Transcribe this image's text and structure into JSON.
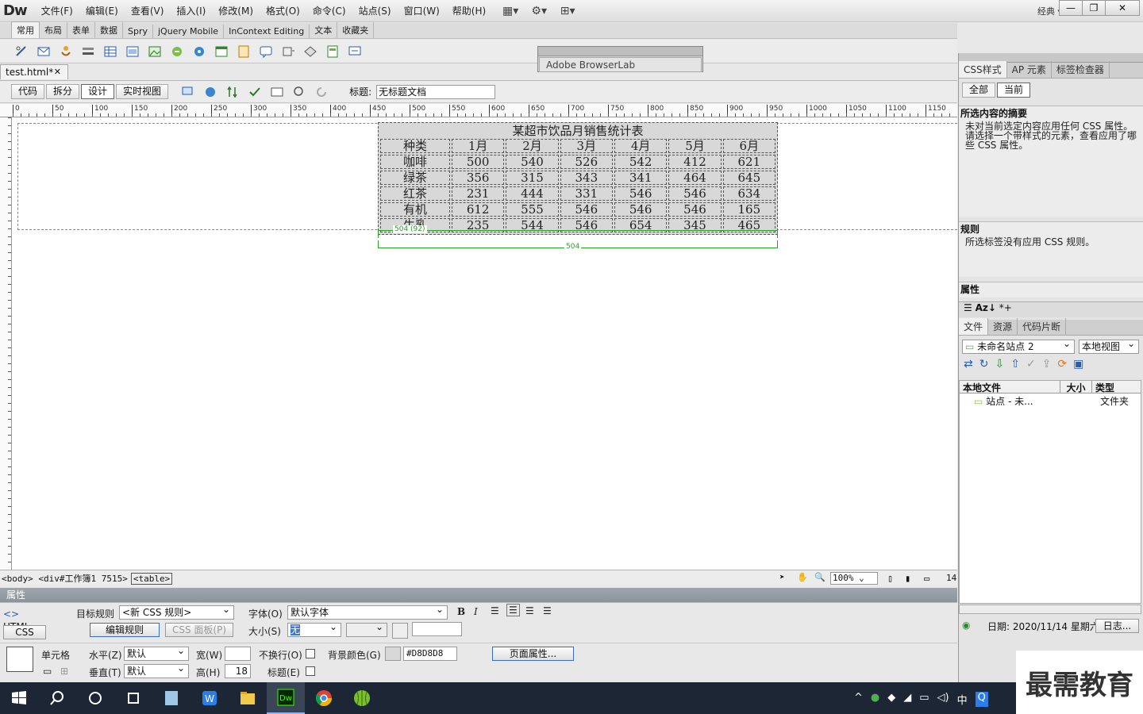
{
  "app": {
    "logo": "Dw",
    "workspace": "经典"
  },
  "menu": [
    "文件(F)",
    "编辑(E)",
    "查看(V)",
    "插入(I)",
    "修改(M)",
    "格式(O)",
    "命令(C)",
    "站点(S)",
    "窗口(W)",
    "帮助(H)"
  ],
  "insert_tabs": [
    "常用",
    "布局",
    "表单",
    "数据",
    "Spry",
    "jQuery Mobile",
    "InContext Editing",
    "文本",
    "收藏夹"
  ],
  "browserlab": {
    "label": "Adobe BrowserLab"
  },
  "doc": {
    "tab": "test.html*",
    "views": [
      "代码",
      "拆分",
      "设计",
      "实时视图"
    ],
    "title_label": "标题:",
    "title_value": "无标题文档"
  },
  "ruler_ticks": [
    "0",
    "50",
    "100",
    "150",
    "200",
    "250",
    "300",
    "350",
    "400",
    "450",
    "500",
    "550",
    "600",
    "650",
    "700",
    "750",
    "800",
    "850",
    "900",
    "950",
    "1000",
    "1050",
    "1100",
    "1150"
  ],
  "table": {
    "caption": "某超市饮品月销售统计表",
    "header": [
      "种类",
      "1月",
      "2月",
      "3月",
      "4月",
      "5月",
      "6月"
    ],
    "rows": [
      [
        "咖啡",
        "500",
        "540",
        "526",
        "542",
        "412",
        "621"
      ],
      [
        "绿茶",
        "356",
        "315",
        "343",
        "341",
        "464",
        "645"
      ],
      [
        "红茶",
        "231",
        "444",
        "331",
        "546",
        "546",
        "634"
      ],
      [
        "有机",
        "612",
        "555",
        "546",
        "546",
        "546",
        "165"
      ],
      [
        "牛乳",
        "235",
        "544",
        "546",
        "654",
        "345",
        "465"
      ]
    ],
    "width_label_1": "504 (92)",
    "width_label_2": "504"
  },
  "statusbar": {
    "tags": "<body> <div#工作簿1 7515>",
    "table_tag": "<table>",
    "zoom": "100%",
    "extra": "14"
  },
  "properties": {
    "header": "属性",
    "html_btn": "HTML",
    "css_btn": "CSS",
    "target_rule_label": "目标规则",
    "target_rule_value": "<新 CSS 规则>",
    "edit_rule": "编辑规则",
    "css_panel": "CSS 面板(P)",
    "font_label": "字体(O)",
    "font_value": "默认字体",
    "size_label": "大小(S)",
    "size_value": "无",
    "cell_label": "单元格",
    "horz_label": "水平(Z)",
    "horz_value": "默认",
    "vert_label": "垂直(T)",
    "vert_value": "默认",
    "width_label": "宽(W)",
    "width_value": "",
    "height_label": "高(H)",
    "height_value": "18",
    "nowrap_label": "不换行(O)",
    "header_label": "标题(E)",
    "bg_label": "背景颜色(G)",
    "bg_value": "#D8D8D8",
    "page_props": "页面属性..."
  },
  "right_panel": {
    "css_tabs": [
      "CSS样式",
      "AP 元素",
      "标签检查器"
    ],
    "mode_tabs": [
      "全部",
      "当前"
    ],
    "summary_title": "所选内容的摘要",
    "summary_text": "未对当前选定内容应用任何 CSS 属性。请选择一个带样式的元素，查看应用了哪些 CSS 属性。",
    "rules_title": "规则",
    "rules_text": "所选标签没有应用 CSS 规则。",
    "props_title": "属性",
    "file_tabs": [
      "文件",
      "资源",
      "代码片断"
    ],
    "site": "未命名站点 2",
    "view": "本地视图",
    "cols": [
      "本地文件",
      "大小",
      "类型"
    ],
    "row": {
      "name": "站点 - 未...",
      "type": "文件夹"
    },
    "date": "日期: 2020/11/14 星期六",
    "log": "日志..."
  },
  "watermark": "最需教育"
}
